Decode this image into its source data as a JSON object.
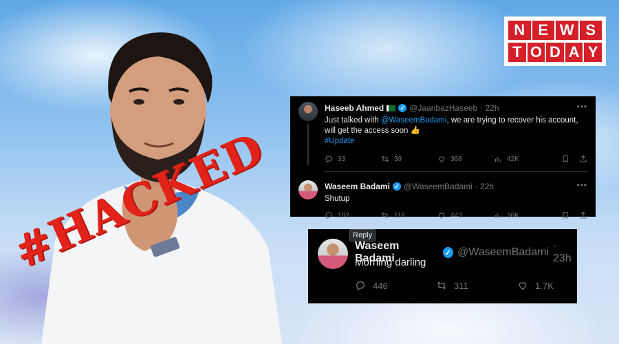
{
  "logo": {
    "row1": [
      "N",
      "E",
      "W",
      "S"
    ],
    "row2": [
      "T",
      "O",
      "D",
      "A",
      "Y"
    ]
  },
  "overlay": {
    "hacked": "#HACKED"
  },
  "thread": [
    {
      "name": "Haseeb Ahmed",
      "handle": "@JaanbazHaseeb",
      "time": "· 22h",
      "text_pre": "Just talked with ",
      "mention": "@WaseemBadami",
      "text_post": ", we are trying to recover his account, will get the access soon 👍",
      "hashtag": "#Update",
      "replies": "33",
      "retweets": "39",
      "likes": "368",
      "views": "42K"
    },
    {
      "name": "Waseem Badami",
      "handle": "@WaseemBadami",
      "time": "· 22h",
      "text": "Shutup",
      "replies": "102",
      "retweets": "116",
      "likes": "443",
      "views": "36K"
    }
  ],
  "reply_tweet": {
    "tag": "Reply",
    "name": "Waseem Badami",
    "handle": "@WaseemBadami",
    "time": "· 23h",
    "text": "Morning darling",
    "replies": "446",
    "retweets": "311",
    "likes": "1.7K"
  },
  "colors": {
    "accent": "#1d9bf0",
    "brand_red": "#d5202a",
    "hacked_red": "#e2231a"
  }
}
